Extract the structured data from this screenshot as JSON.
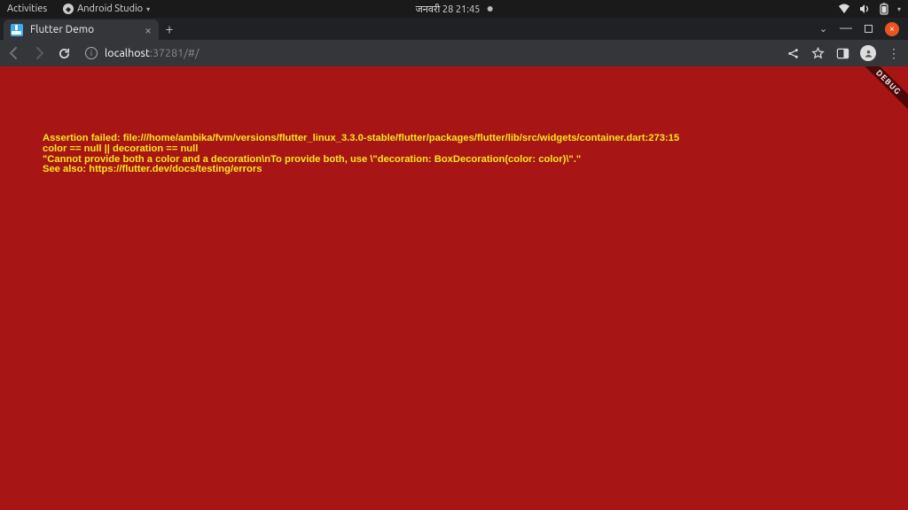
{
  "system": {
    "activities_label": "Activities",
    "active_app": "Android Studio",
    "clock": "जनवरी 28  21:45"
  },
  "browser": {
    "tab": {
      "title": "Flutter Demo"
    },
    "address": {
      "host": "localhost",
      "rest": ":37281/#/"
    }
  },
  "error": {
    "line1": "Assertion failed: file:///home/ambika/fvm/versions/flutter_linux_3.3.0-stable/flutter/packages/flutter/lib/src/widgets/container.dart:273:15",
    "line2": "color == null || decoration == null",
    "line3": "\"Cannot provide both a color and a decoration\\nTo provide both, use \\\"decoration: BoxDecoration(color: color)\\\".\"",
    "line4": "See also: https://flutter.dev/docs/testing/errors"
  },
  "debug_label": "DEBUG"
}
